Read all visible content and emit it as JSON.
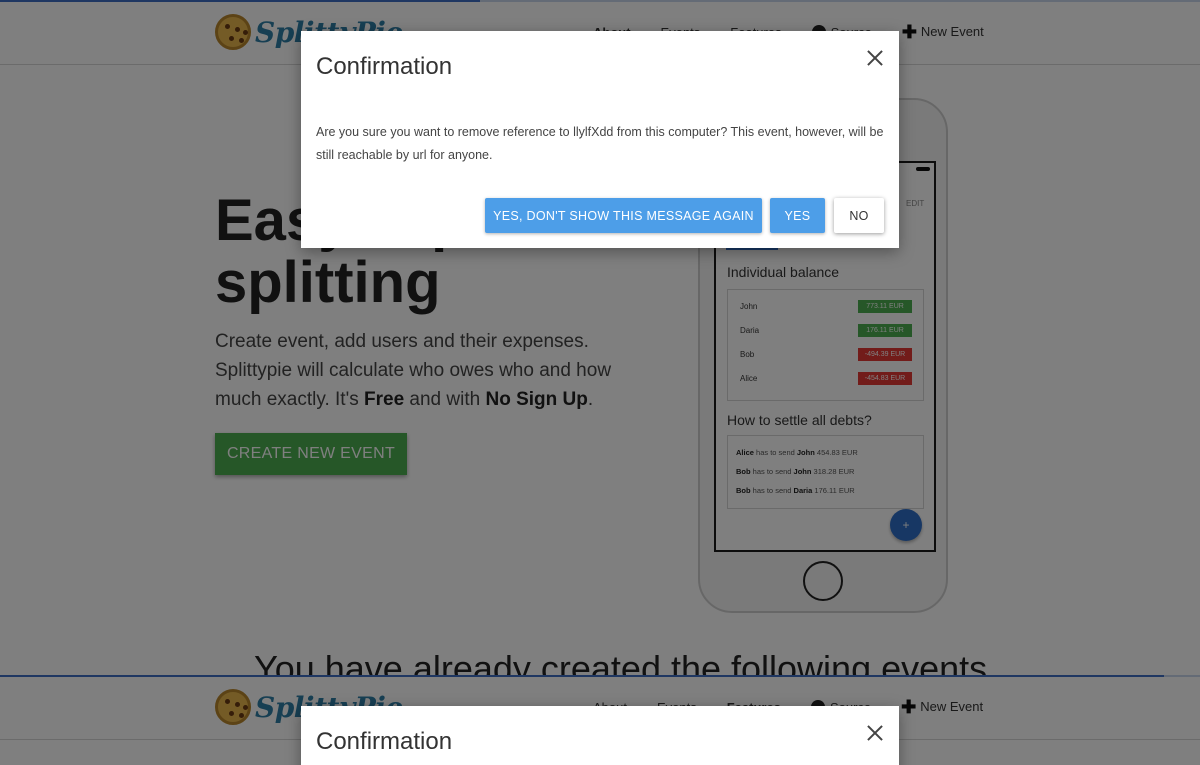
{
  "app": {
    "logo_text": "SplittyPie",
    "nav": {
      "about": "About",
      "events": "Events",
      "features": "Features",
      "source": "Source",
      "new_event": "New Event"
    }
  },
  "page_1": {
    "progress": 0.4,
    "active_nav": "About"
  },
  "page_2": {
    "progress": 0.97,
    "active_nav": "Features"
  },
  "hero": {
    "title": "Easy expenses splitting",
    "desc_part1": "Create event, add users and their expenses. Splittypie will calculate who owes who and how much exactly. It's ",
    "desc_free": "Free",
    "desc_part2": " and with ",
    "desc_nosignup": "No Sign Up",
    "desc_part3": ".",
    "cta_label": "CREATE NEW EVENT"
  },
  "phone_mockup": {
    "edit_label": "EDIT",
    "balance_title": "Individual balance",
    "balances": [
      {
        "name": "John",
        "amount": "773.11 EUR",
        "status": "positive"
      },
      {
        "name": "Daria",
        "amount": "176.11 EUR",
        "status": "positive"
      },
      {
        "name": "Bob",
        "amount": "-494.39 EUR",
        "status": "negative"
      },
      {
        "name": "Alice",
        "amount": "-454.83 EUR",
        "status": "negative"
      }
    ],
    "settle_title": "How to settle all debts?",
    "settlements": [
      {
        "from": "Alice",
        "to": "John",
        "amount": "454.83 EUR"
      },
      {
        "from": "Bob",
        "to": "John",
        "amount": "318.28 EUR"
      },
      {
        "from": "Bob",
        "to": "Daria",
        "amount": "176.11 EUR"
      }
    ],
    "settle_verb": "has to send",
    "fab_label": "+"
  },
  "events_heading": "You have already created the following events",
  "modal": {
    "title": "Confirmation",
    "body": "Are you sure you want to remove reference to llylfXdd from this computer? This event, however, will be still reachable by url for anyone.",
    "btn_yes_dont_show": "YES, DON'T SHOW THIS MESSAGE AGAIN",
    "btn_yes": "YES",
    "btn_no": "NO"
  },
  "colors": {
    "primary_blue": "#4d9ee8",
    "cta_green": "#4caf50",
    "positive_badge": "#4caf50",
    "negative_badge": "#e53935",
    "logo_blue": "#2f7fa6"
  }
}
